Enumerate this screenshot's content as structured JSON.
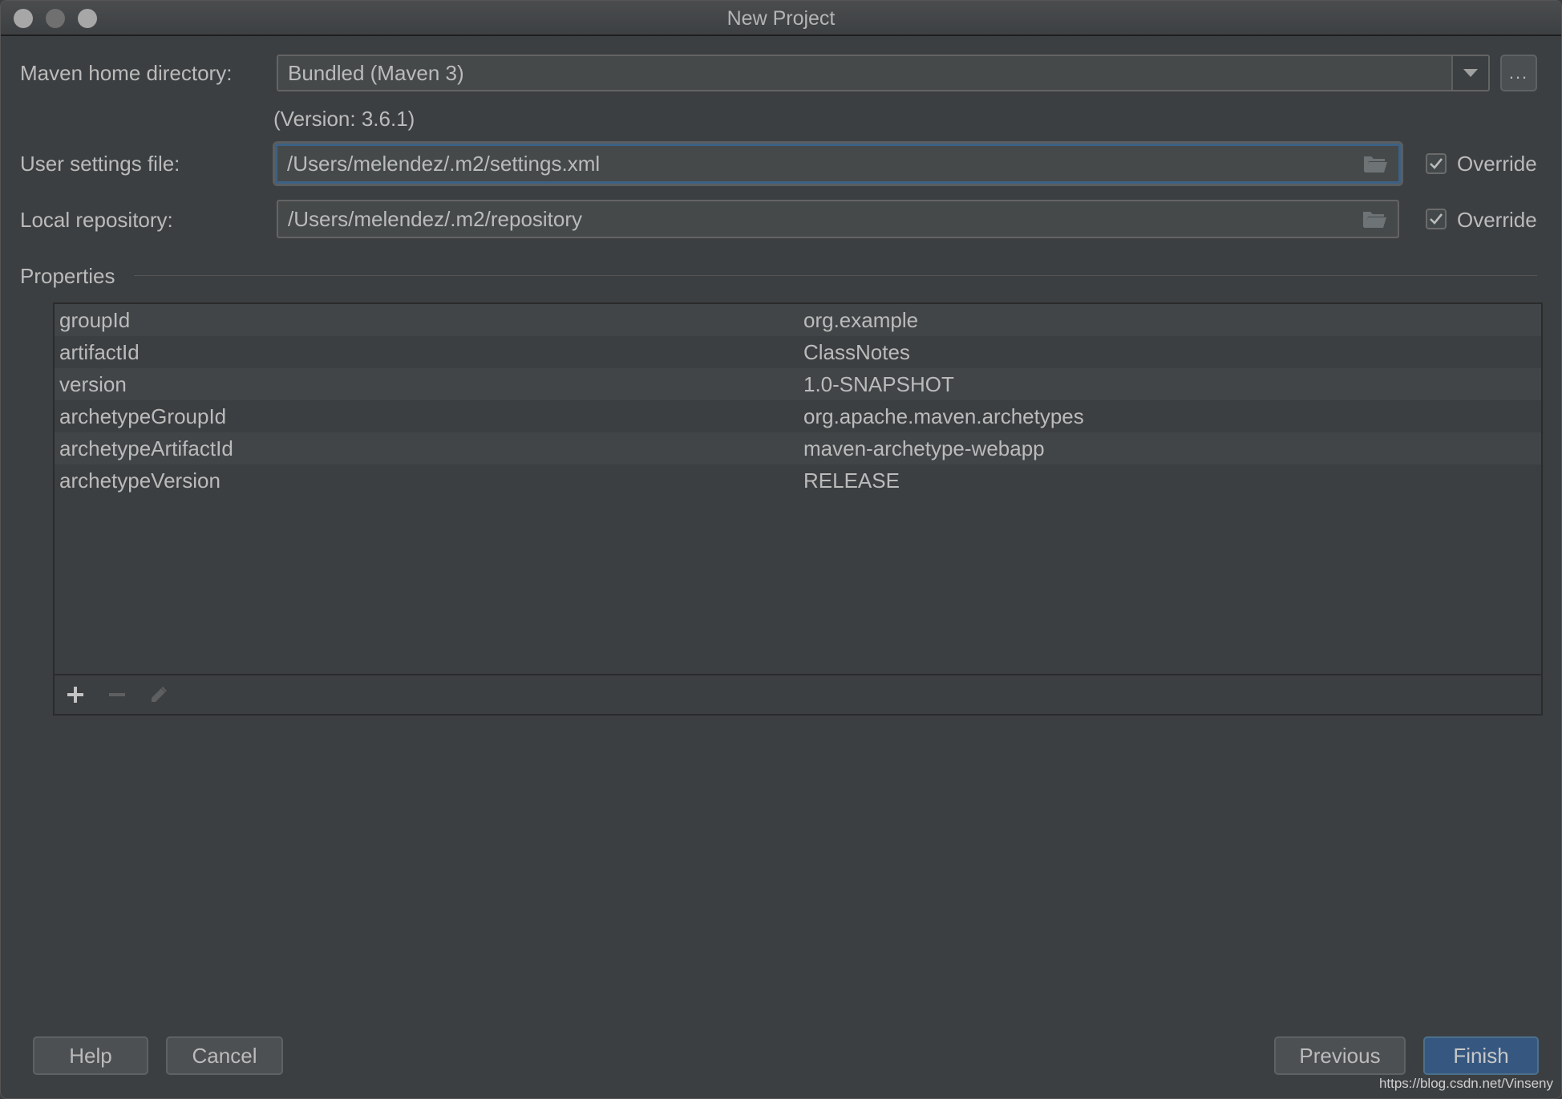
{
  "window": {
    "title": "New Project"
  },
  "maven_home": {
    "label": "Maven home directory:",
    "value": "Bundled (Maven 3)",
    "browse_label": "...",
    "version_text": "(Version: 3.6.1)"
  },
  "user_settings": {
    "label": "User settings file:",
    "value": "/Users/melendez/.m2/settings.xml",
    "override_label": "Override",
    "override_checked": true
  },
  "local_repository": {
    "label": "Local repository:",
    "value": "/Users/melendez/.m2/repository",
    "override_label": "Override",
    "override_checked": true
  },
  "properties": {
    "title": "Properties",
    "rows": [
      {
        "key": "groupId",
        "value": "org.example"
      },
      {
        "key": "artifactId",
        "value": "ClassNotes"
      },
      {
        "key": "version",
        "value": "1.0-SNAPSHOT"
      },
      {
        "key": "archetypeGroupId",
        "value": "org.apache.maven.archetypes"
      },
      {
        "key": "archetypeArtifactId",
        "value": "maven-archetype-webapp"
      },
      {
        "key": "archetypeVersion",
        "value": "RELEASE"
      }
    ],
    "toolbar": [
      "add-icon",
      "remove-icon",
      "edit-icon"
    ]
  },
  "buttons": {
    "help": "Help",
    "cancel": "Cancel",
    "previous": "Previous",
    "finish": "Finish"
  },
  "watermark": "https://blog.csdn.net/Vinseny",
  "colors": {
    "background": "#3c3f41",
    "accent_focus": "#3d6185",
    "primary_button": "#365880"
  }
}
